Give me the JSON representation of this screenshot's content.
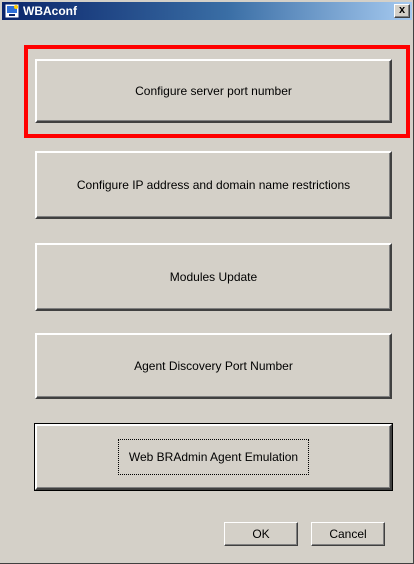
{
  "window": {
    "title": "WBAconf",
    "close_glyph": "x"
  },
  "buttons": {
    "configure_port": "Configure server port number",
    "ip_restrictions": "Configure IP address and domain name restrictions",
    "modules_update": "Modules Update",
    "agent_discovery": "Agent Discovery Port Number",
    "agent_emulation": "Web BRAdmin Agent Emulation"
  },
  "dialog": {
    "ok_label": "OK",
    "cancel_label": "Cancel"
  },
  "colors": {
    "highlight": "#ff0000",
    "titlebar": "#0a246a",
    "face": "#d4d0c8"
  }
}
